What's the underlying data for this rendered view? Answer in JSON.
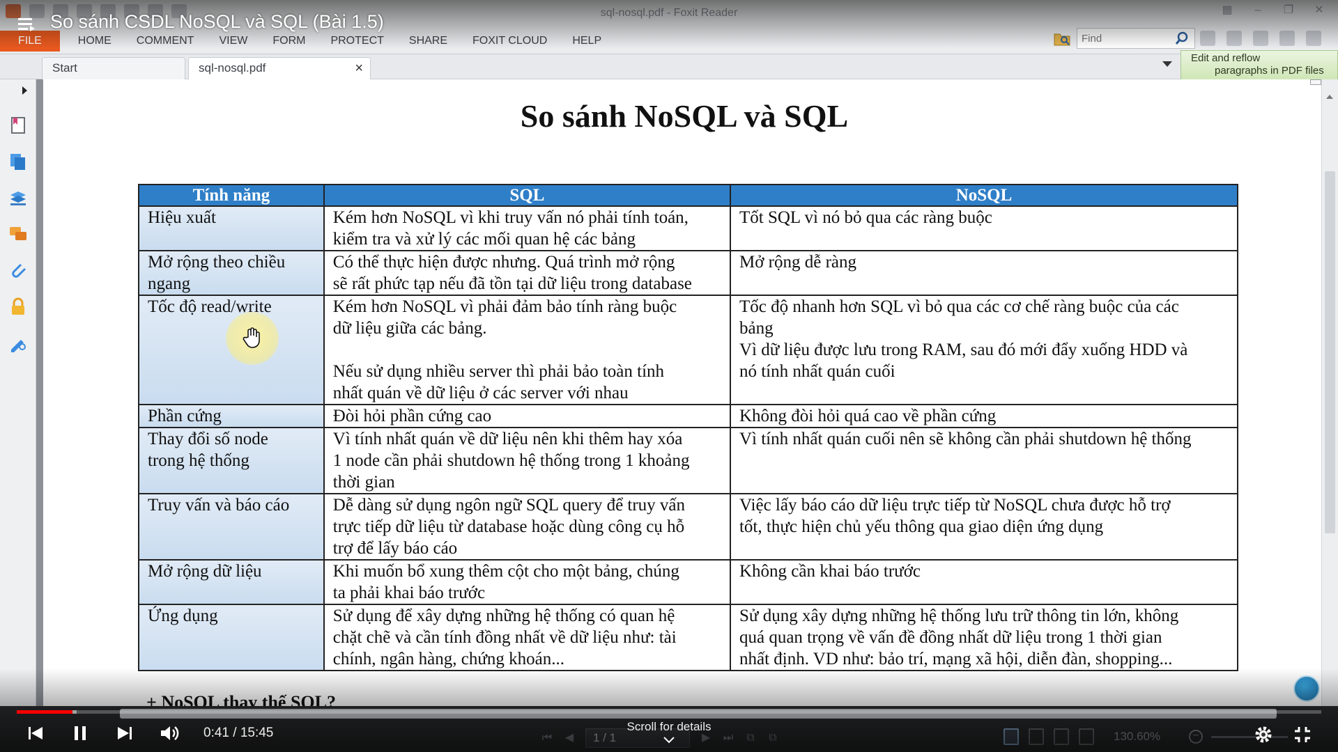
{
  "window": {
    "title": "sql-nosql.pdf - Foxit Reader"
  },
  "menu": {
    "items": [
      "FILE",
      "HOME",
      "COMMENT",
      "VIEW",
      "FORM",
      "PROTECT",
      "SHARE",
      "FOXIT CLOUD",
      "HELP"
    ]
  },
  "find": {
    "placeholder": "Find"
  },
  "tabs": {
    "start": "Start",
    "document": "sql-nosql.pdf",
    "close": "×"
  },
  "promo": {
    "line1": "Edit and reflow",
    "line2": "paragraphs in PDF files"
  },
  "document": {
    "title": "So sánh NoSQL và SQL",
    "headers": [
      "Tính năng",
      "SQL",
      "NoSQL"
    ],
    "rows": [
      {
        "feature": [
          "Hiệu xuất"
        ],
        "sql": [
          "Kém hơn NoSQL vì khi truy vấn nó phải tính toán,",
          "kiểm tra và xử lý các mối quan hệ các bảng"
        ],
        "nosql": [
          "Tốt SQL vì nó bỏ qua các ràng buộc"
        ]
      },
      {
        "feature": [
          "Mở rộng theo chiều",
          "ngang"
        ],
        "sql": [
          "Có thể thực hiện được nhưng. Quá trình mở rộng",
          "sẽ rất phức tạp nếu đã tồn tại dữ liệu trong database"
        ],
        "nosql": [
          "Mở rộng dễ ràng"
        ]
      },
      {
        "feature": [
          "Tốc độ read/write"
        ],
        "sql": [
          "Kém hơn NoSQL vì phải đảm bảo tính ràng buộc",
          "dữ liệu giữa các bảng.",
          "",
          "Nếu sử dụng nhiều server thì phải bảo toàn tính",
          "nhất quán về dữ liệu ở các server với nhau"
        ],
        "nosql": [
          "Tốc độ nhanh hơn SQL vì bỏ qua các cơ chế ràng buộc của các",
          "bảng",
          "Vì dữ liệu được lưu trong RAM, sau đó mới đẩy xuống HDD và",
          "nó tính nhất quán cuối"
        ]
      },
      {
        "feature": [
          "Phần cứng"
        ],
        "sql": [
          "Đòi hỏi phần cứng cao"
        ],
        "nosql": [
          "Không đòi hỏi quá cao về phần cứng"
        ]
      },
      {
        "feature": [
          "Thay đổi số node",
          "trong hệ thống"
        ],
        "sql": [
          "Vì tính nhất quán về dữ liệu nên khi thêm hay xóa",
          "1 node cần phải shutdown hệ thống trong 1 khoảng",
          "thời gian"
        ],
        "nosql": [
          "Vì tính nhất quán cuối nên sẽ không cần phải shutdown hệ thống"
        ]
      },
      {
        "feature": [
          "Truy vấn và báo cáo"
        ],
        "sql": [
          "Dễ dàng sử dụng ngôn ngữ SQL query để truy vấn",
          "trực tiếp dữ liệu từ database hoặc dùng công cụ hỗ",
          "trợ để lấy báo cáo"
        ],
        "nosql": [
          "Việc lấy báo cáo dữ liệu trực tiếp từ NoSQL chưa được hỗ trợ",
          "tốt, thực hiện chủ yếu thông qua giao diện ứng dụng"
        ]
      },
      {
        "feature": [
          "Mở rộng dữ liệu"
        ],
        "sql": [
          "Khi muốn bổ xung thêm cột cho một bảng, chúng",
          "ta phải khai báo trước"
        ],
        "nosql": [
          "Không cần khai báo trước"
        ]
      },
      {
        "feature": [
          "Ứng dụng"
        ],
        "sql": [
          "Sử dụng để xây dựng những hệ thống có quan hệ",
          "chặt chẽ và cần tính đồng nhất về dữ liệu như: tài",
          "chính, ngân hàng, chứng khoán..."
        ],
        "nosql": [
          "Sử dụng xây dựng những hệ thống lưu trữ thông tin lớn, không",
          "quá quan trọng về vấn đề đồng nhất dữ liệu trong 1 thời gian",
          "nhất định. VD như: bảo trí, mạng xã hội, diễn đàn, shopping..."
        ]
      }
    ],
    "next_heading": "+ NoSQL thay thế SQL?"
  },
  "statusbar": {
    "page": "1 / 1",
    "zoom": "130.60%"
  },
  "video": {
    "title": "So sánh CSDL NoSQL và SQL (Bài 1.5)",
    "current_time": "0:41",
    "duration": "15:45",
    "time_display": "0:41 / 15:45",
    "played_fraction": 0.043,
    "buffered_fraction": 0.046,
    "scroll_hint": "Scroll for details"
  }
}
